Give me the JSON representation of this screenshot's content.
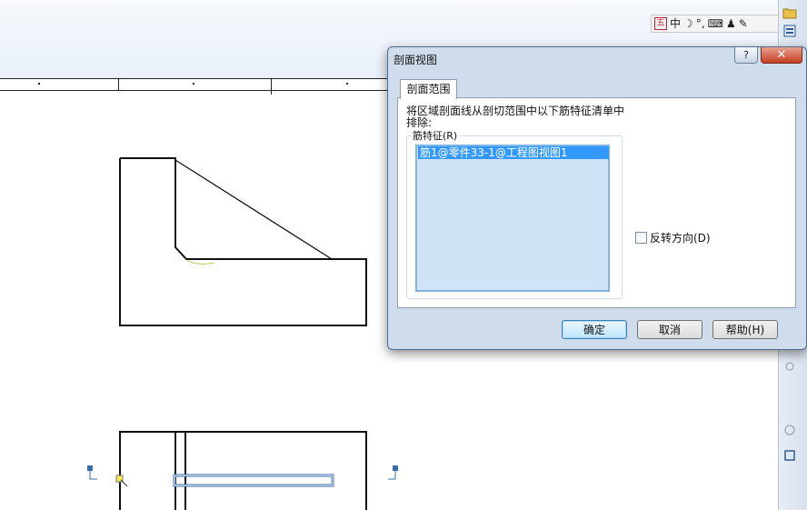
{
  "ime_bar": {
    "items": [
      "五",
      "中",
      "☽",
      "°,",
      "⌨",
      "♟",
      "✎"
    ]
  },
  "dialog": {
    "title": "剖面视图",
    "help_label": "?",
    "close_label": "✕",
    "tab_label": "剖面范围",
    "description": "将区域剖面线从剖切范围中以下筋特征清单中排除:",
    "group_label": "筋特征(R)",
    "list_items": [
      "筋1@零件33-1@工程图视图1"
    ],
    "checkbox_label": "反转方向(D)",
    "checkbox_checked": false,
    "ok_label": "确定",
    "cancel_label": "取消",
    "help_button_label": "帮助(H)"
  },
  "colors": {
    "selection": "#3399ff",
    "highlight_edge": "#3a6ea8",
    "dialog_frame": "#cfdcec"
  }
}
